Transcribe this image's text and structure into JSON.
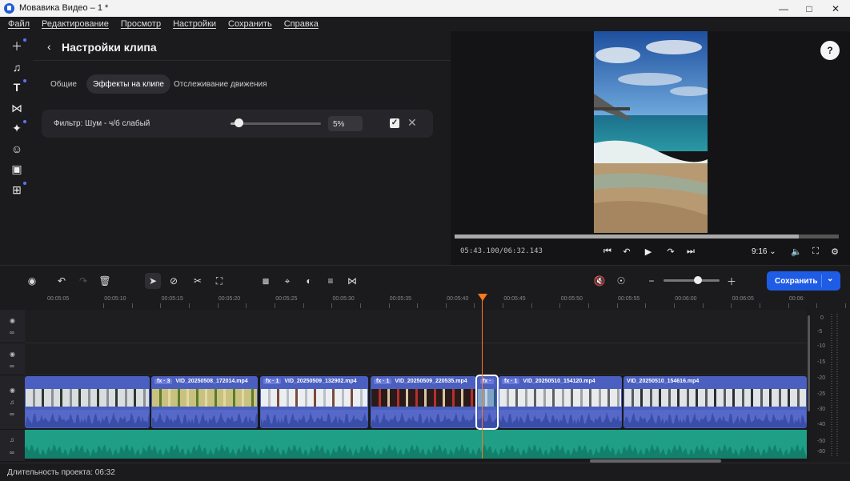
{
  "window": {
    "title": "Мовавика Видео – 1 *",
    "controls": [
      "minimize-icon",
      "maximize-icon",
      "close-icon"
    ]
  },
  "menu": [
    "Файл",
    "Редактирование",
    "Просмотр",
    "Настройки",
    "Сохранить",
    "Справка"
  ],
  "sidebar": {
    "icons": [
      "plus-icon",
      "music-icon",
      "text-icon",
      "transition-icon",
      "magic-icon",
      "sticker-icon",
      "puzzle-icon",
      "apps-icon"
    ]
  },
  "clip_settings": {
    "back": "‹",
    "title": "Настройки клипа",
    "tabs": [
      {
        "label": "Общие",
        "active": false
      },
      {
        "label": "Эффекты на клипе",
        "active": true
      },
      {
        "label": "Отслеживание движения",
        "active": false
      }
    ],
    "filter": {
      "label": "Фильтр: Шум - ч/б слабый",
      "value": "5%",
      "level": 0.05,
      "checked": true
    }
  },
  "preview": {
    "help": "?",
    "timecode": "05:43.100/06:32.143",
    "progress": 0.895,
    "aspect": "9:16"
  },
  "toolbar": {
    "save_label": "Сохранить"
  },
  "ruler": [
    "00:05:05",
    "00:05:10",
    "00:05:15",
    "00:05:20",
    "00:05:25",
    "00:05:30",
    "00:05:35",
    "00:05:40",
    "00:05:45",
    "00:05:50",
    "00:05:55",
    "00:06:00",
    "00:06:05",
    "00:06:"
  ],
  "clips": [
    {
      "name": "",
      "fx": ""
    },
    {
      "name": "VID_20250508_172014.mp4",
      "fx": "fx · 3"
    },
    {
      "name": "VID_20250509_132902.mp4",
      "fx": "fx · 1"
    },
    {
      "name": "VID_20250509_220535.mp4",
      "fx": "fx · 1"
    },
    {
      "name": "",
      "fx": "fx ·"
    },
    {
      "name": "VID_20250510_154120.mp4",
      "fx": "fx · 1"
    },
    {
      "name": "VID_20250510_154616.mp4",
      "fx": ""
    }
  ],
  "vu_meter": [
    "0",
    "-5",
    "-10",
    "-15",
    "-20",
    "-25",
    "-30",
    "-40",
    "-50",
    "-60"
  ],
  "status": {
    "duration": "Длительность проекта: 06:32"
  },
  "colors": {
    "accent": "#1f5ce6",
    "playhead": "#ff7a1a",
    "clip": "#4a5fbf",
    "audio": "#1e9f86"
  }
}
